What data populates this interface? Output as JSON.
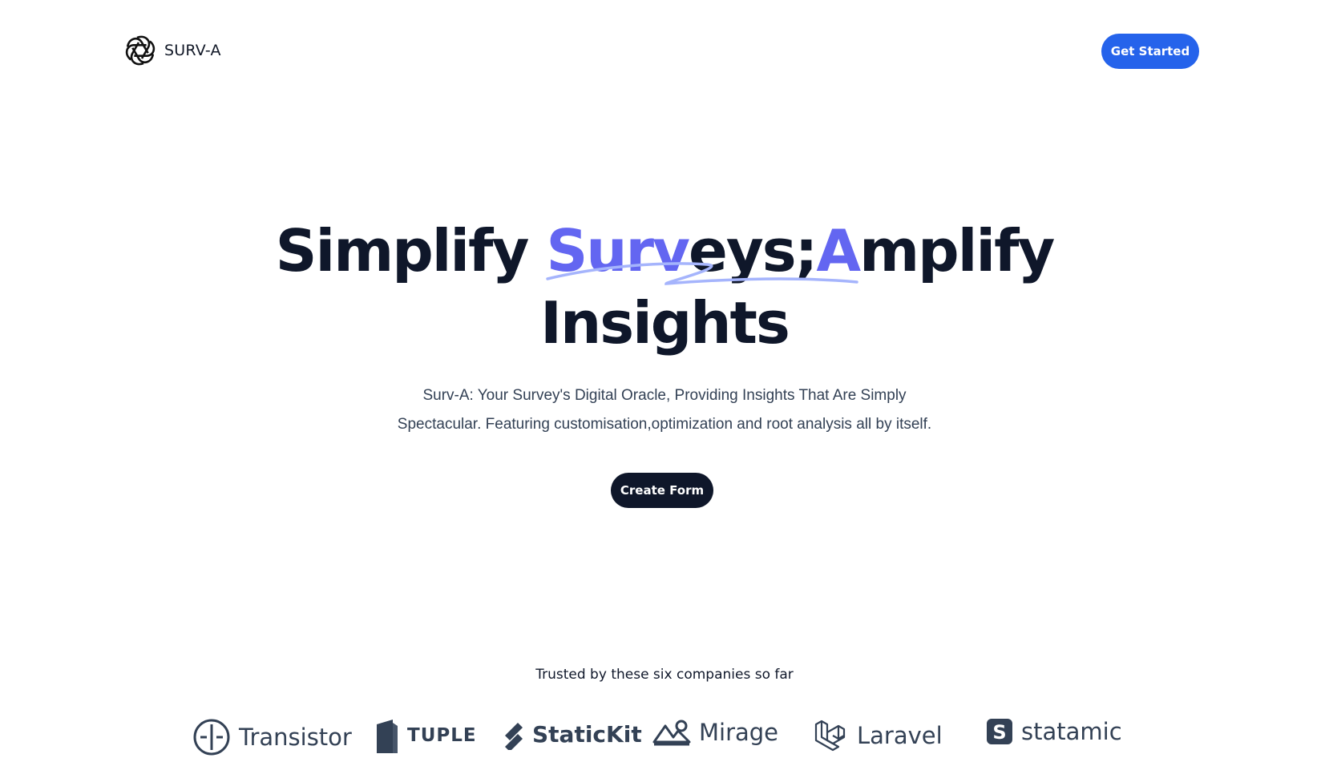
{
  "brand": {
    "name": "SURV-A",
    "logo_icon": "openai-knot-icon"
  },
  "nav": {
    "cta_label": "Get Started",
    "cta_color": "#2563eb"
  },
  "hero": {
    "title_part1": "Simplify ",
    "title_accent1": "Surv",
    "title_part2": "eys; ",
    "title_accent2": "A",
    "title_part3": "mplify",
    "title_line2": "Insights",
    "accent_color": "#6366f1",
    "subtitle_line1": "Surv-A: Your Survey's Digital Oracle, Providing Insights That Are Simply",
    "subtitle_line2": "Spectacular. Featuring customisation,optimization and root analysis all by itself.",
    "button_label": "Create Form"
  },
  "trusted": {
    "heading": "Trusted by these six companies so far",
    "companies": [
      {
        "name": "Transistor",
        "icon": "transistor-icon"
      },
      {
        "name": "TUPLE",
        "icon": "tuple-icon"
      },
      {
        "name": "StaticKit",
        "icon": "statickit-icon"
      },
      {
        "name": "Mirage",
        "icon": "mirage-icon"
      },
      {
        "name": "Laravel",
        "icon": "laravel-icon"
      },
      {
        "name": "statamic",
        "icon": "statamic-icon"
      }
    ]
  }
}
